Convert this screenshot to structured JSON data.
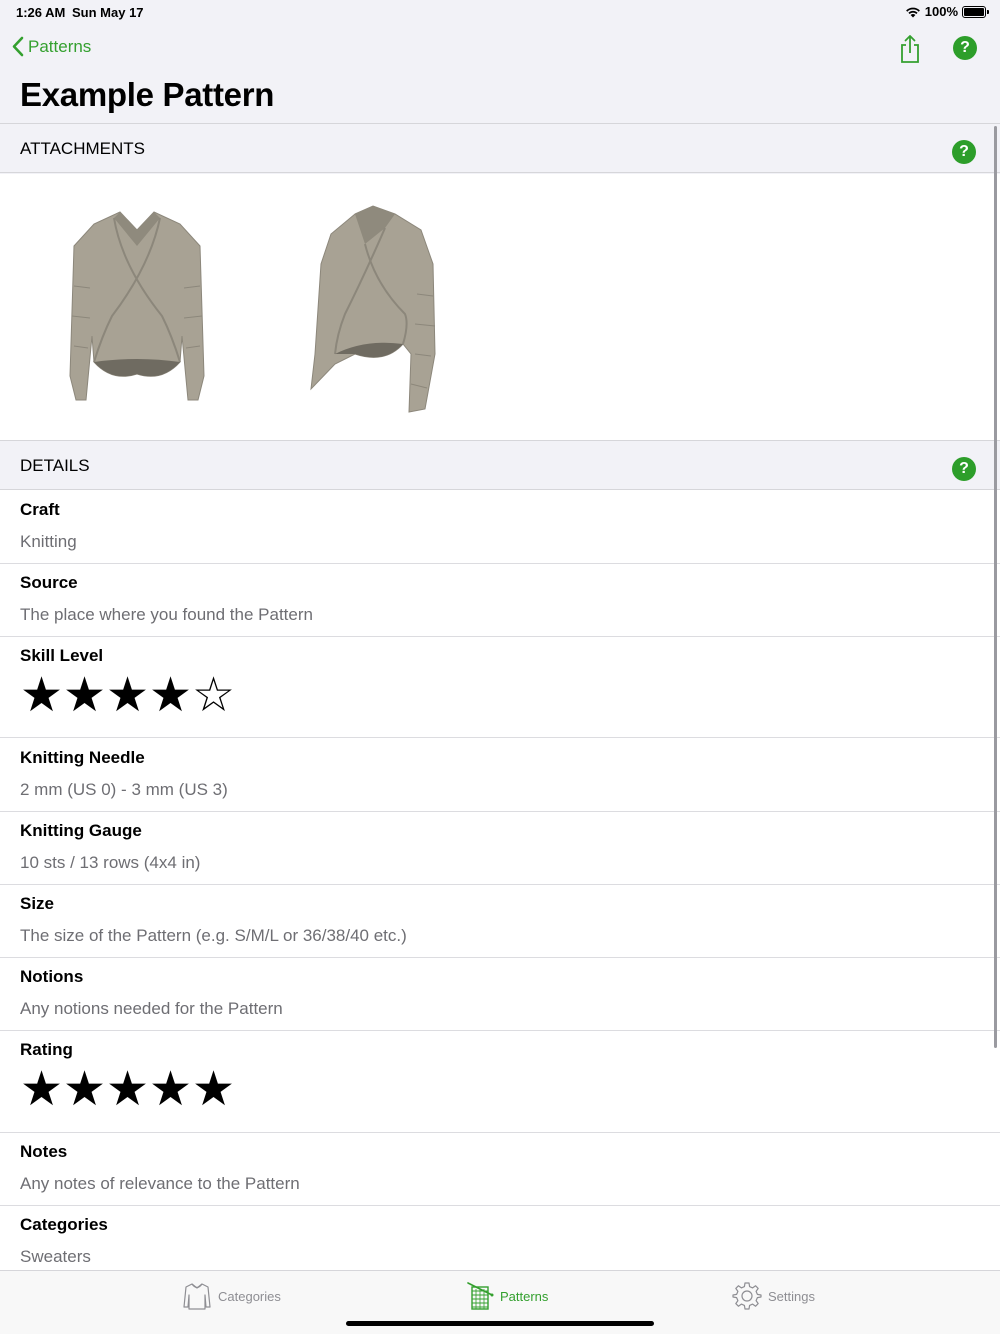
{
  "status_bar": {
    "time": "1:26 AM",
    "date": "Sun May 17",
    "battery": "100%"
  },
  "nav": {
    "back_label": "Patterns"
  },
  "page_title": "Example Pattern",
  "sections": {
    "attachments": {
      "label": "ATTACHMENTS"
    },
    "details": {
      "label": "DETAILS"
    }
  },
  "details": {
    "craft": {
      "label": "Craft",
      "value": "Knitting"
    },
    "source": {
      "label": "Source",
      "value": "The place where you found the Pattern"
    },
    "skill_level": {
      "label": "Skill Level",
      "rating": 4,
      "max": 5
    },
    "needle": {
      "label": "Knitting Needle",
      "value": "2 mm (US 0) - 3 mm (US 3)"
    },
    "gauge": {
      "label": "Knitting Gauge",
      "value": "10 sts / 13 rows (4x4 in)"
    },
    "size": {
      "label": "Size",
      "value": "The size of the Pattern (e.g. S/M/L or 36/38/40 etc.)"
    },
    "notions": {
      "label": "Notions",
      "value": "Any notions needed for the Pattern"
    },
    "rating": {
      "label": "Rating",
      "rating": 5,
      "max": 5
    },
    "notes": {
      "label": "Notes",
      "value": "Any notes of relevance to the Pattern"
    },
    "categories": {
      "label": "Categories",
      "value": "Sweaters"
    }
  },
  "tab_bar": {
    "tabs": [
      {
        "label": "Categories",
        "icon": "sweater-icon"
      },
      {
        "label": "Patterns",
        "icon": "pattern-icon",
        "active": true
      },
      {
        "label": "Settings",
        "icon": "gear-icon"
      }
    ]
  },
  "colors": {
    "accent": "#34a02f",
    "help": "#2d9e2a",
    "sweater": "#a8a294"
  }
}
